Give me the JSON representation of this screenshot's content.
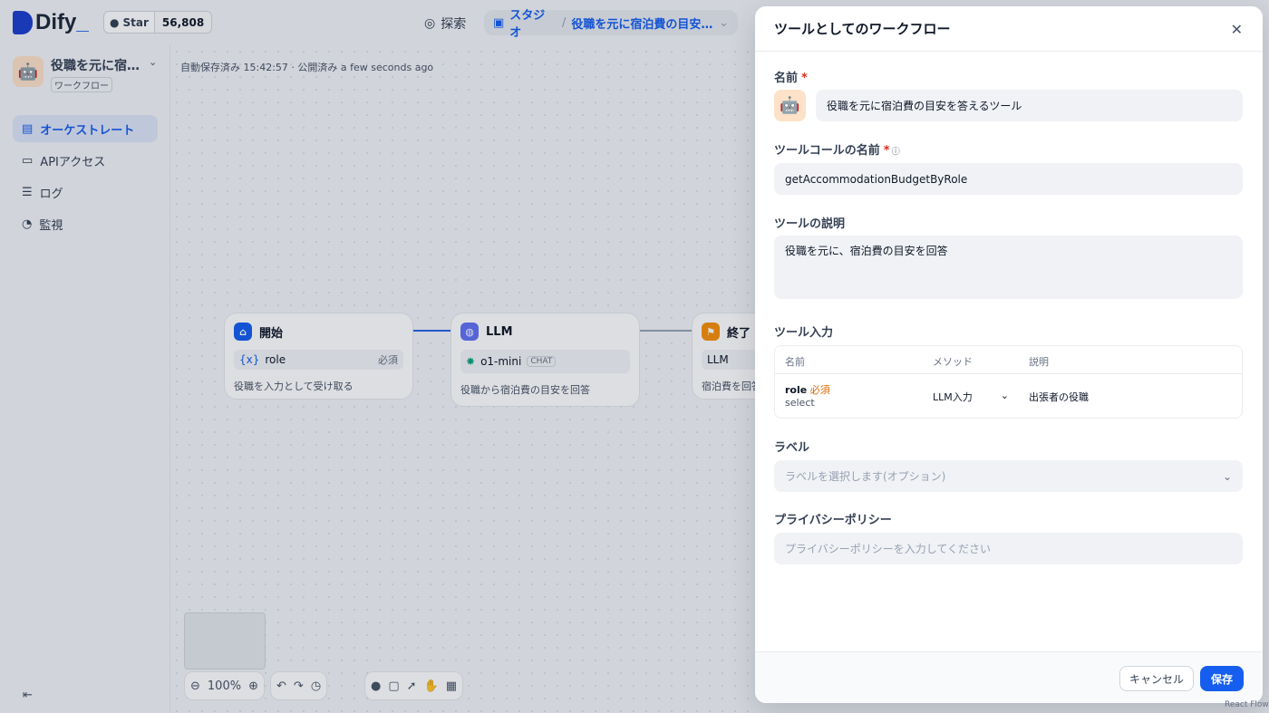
{
  "header": {
    "logo_text": "Dify",
    "logo_suffix": "_",
    "github_star": "Star",
    "github_count": "56,808",
    "explore": "探索",
    "studio": "スタジオ",
    "app_breadcrumb": "役職を元に宿泊費の目安..."
  },
  "sidebar": {
    "app_name": "役職を元に宿泊...",
    "app_type": "ワークフロー",
    "items": [
      {
        "label": "オーケストレート",
        "icon": "layout-icon"
      },
      {
        "label": "APIアクセス",
        "icon": "terminal-icon"
      },
      {
        "label": "ログ",
        "icon": "file-list-icon"
      },
      {
        "label": "監視",
        "icon": "dashboard-icon"
      }
    ]
  },
  "canvas": {
    "autosave": "自動保存済み 15:42:57 · 公開済み a few seconds ago",
    "nodes": {
      "start": {
        "title": "開始",
        "var": "role",
        "required": "必須",
        "desc": "役職を入力として受け取る"
      },
      "llm": {
        "title": "LLM",
        "model": "o1-mini",
        "mode": "CHAT",
        "desc": "役職から宿泊費の目安を回答"
      },
      "end": {
        "title": "終了",
        "var": "LLM",
        "desc": "宿泊費を回答"
      }
    },
    "zoom": "100%"
  },
  "drawer": {
    "title": "ツールとしてのワークフロー",
    "name_label": "名前",
    "name_value": "役職を元に宿泊費の目安を答えるツール",
    "call_name_label": "ツールコールの名前",
    "call_name_value": "getAccommodationBudgetByRole",
    "desc_label": "ツールの説明",
    "desc_value": "役職を元に、宿泊費の目安を回答",
    "inputs_label": "ツール入力",
    "table_headers": {
      "name": "名前",
      "method": "メソッド",
      "desc": "説明"
    },
    "table_row": {
      "name": "role",
      "required": "必須",
      "type": "select",
      "method": "LLM入力",
      "desc": "出張者の役職"
    },
    "label_label": "ラベル",
    "label_placeholder": "ラベルを選択します(オプション)",
    "privacy_label": "プライバシーポリシー",
    "privacy_placeholder": "プライバシーポリシーを入力してください",
    "cancel": "キャンセル",
    "save": "保存"
  },
  "react_flow": "React Flow",
  "colors": {
    "accent": "#155eef",
    "required": "#d92d20",
    "start_node": "#155eef",
    "llm_node": "#6172f3",
    "end_node": "#f79009"
  }
}
